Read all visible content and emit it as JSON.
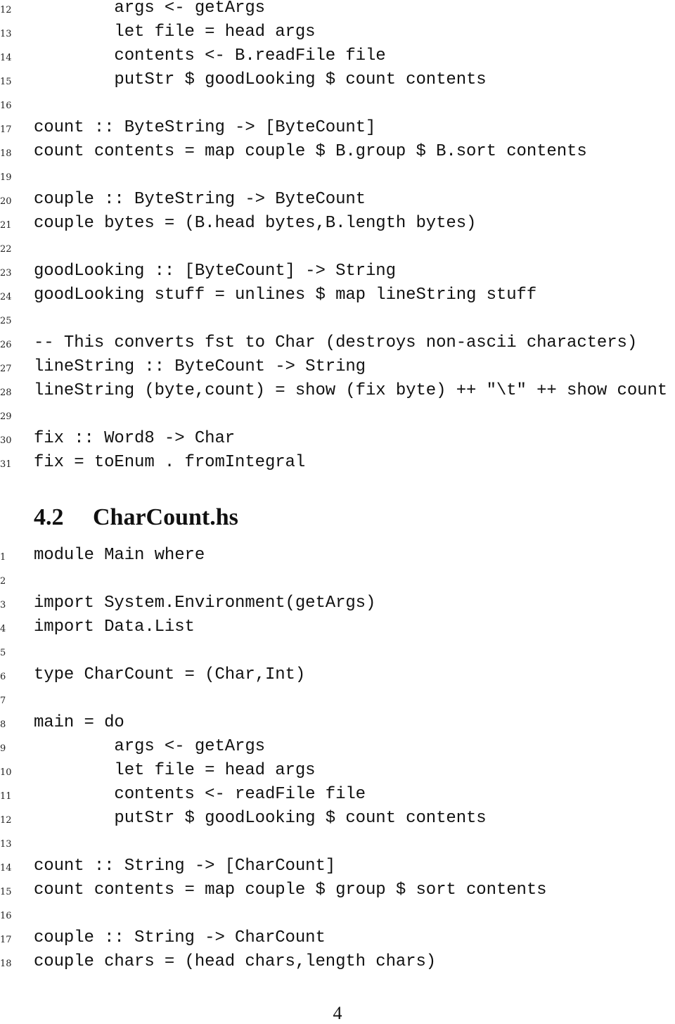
{
  "block1": {
    "lines": [
      {
        "n": "12",
        "text": "        args <- getArgs"
      },
      {
        "n": "13",
        "text": "        let file = head args"
      },
      {
        "n": "14",
        "text": "        contents <- B.readFile file"
      },
      {
        "n": "15",
        "text": "        putStr $ goodLooking $ count contents"
      },
      {
        "n": "16",
        "text": ""
      },
      {
        "n": "17",
        "text": "count :: ByteString -> [ByteCount]"
      },
      {
        "n": "18",
        "text": "count contents = map couple $ B.group $ B.sort contents"
      },
      {
        "n": "19",
        "text": ""
      },
      {
        "n": "20",
        "text": "couple :: ByteString -> ByteCount"
      },
      {
        "n": "21",
        "text": "couple bytes = (B.head bytes,B.length bytes)"
      },
      {
        "n": "22",
        "text": ""
      },
      {
        "n": "23",
        "text": "goodLooking :: [ByteCount] -> String"
      },
      {
        "n": "24",
        "text": "goodLooking stuff = unlines $ map lineString stuff"
      },
      {
        "n": "25",
        "text": ""
      },
      {
        "n": "26",
        "text": "-- This converts fst to Char (destroys non-ascii characters)"
      },
      {
        "n": "27",
        "text": "lineString :: ByteCount -> String"
      },
      {
        "n": "28",
        "text": "lineString (byte,count) = show (fix byte) ++ \"\\t\" ++ show count"
      },
      {
        "n": "29",
        "text": ""
      },
      {
        "n": "30",
        "text": "fix :: Word8 -> Char"
      },
      {
        "n": "31",
        "text": "fix = toEnum . fromIntegral"
      }
    ]
  },
  "section": {
    "number": "4.2",
    "title": "CharCount.hs"
  },
  "block2": {
    "lines": [
      {
        "n": "1",
        "text": "module Main where"
      },
      {
        "n": "2",
        "text": ""
      },
      {
        "n": "3",
        "text": "import System.Environment(getArgs)"
      },
      {
        "n": "4",
        "text": "import Data.List"
      },
      {
        "n": "5",
        "text": ""
      },
      {
        "n": "6",
        "text": "type CharCount = (Char,Int)"
      },
      {
        "n": "7",
        "text": ""
      },
      {
        "n": "8",
        "text": "main = do"
      },
      {
        "n": "9",
        "text": "        args <- getArgs"
      },
      {
        "n": "10",
        "text": "        let file = head args"
      },
      {
        "n": "11",
        "text": "        contents <- readFile file"
      },
      {
        "n": "12",
        "text": "        putStr $ goodLooking $ count contents"
      },
      {
        "n": "13",
        "text": ""
      },
      {
        "n": "14",
        "text": "count :: String -> [CharCount]"
      },
      {
        "n": "15",
        "text": "count contents = map couple $ group $ sort contents"
      },
      {
        "n": "16",
        "text": ""
      },
      {
        "n": "17",
        "text": "couple :: String -> CharCount"
      },
      {
        "n": "18",
        "text": "couple chars = (head chars,length chars)"
      }
    ]
  },
  "footer": {
    "page_number": "4"
  }
}
